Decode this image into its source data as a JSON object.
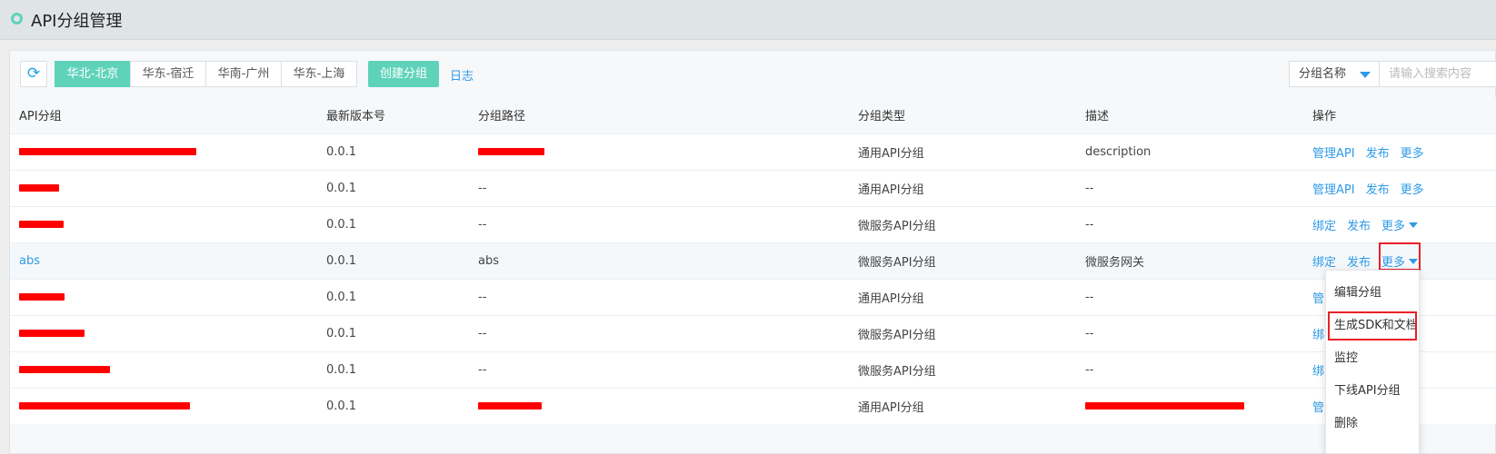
{
  "page": {
    "title": "API分组管理"
  },
  "toolbar": {
    "refresh_icon": "refresh-icon",
    "regions": [
      "华北-北京",
      "华东-宿迁",
      "华南-广州",
      "华东-上海"
    ],
    "active_region": "华北-北京",
    "create_label": "创建分组",
    "log_label": "日志",
    "search_field": "分组名称",
    "search_placeholder": "请输入搜索内容"
  },
  "table": {
    "headers": [
      "API分组",
      "最新版本号",
      "分组路径",
      "分组类型",
      "描述",
      "操作"
    ],
    "rows": [
      {
        "name": "",
        "version": "0.0.1",
        "path": "",
        "type": "通用API分组",
        "desc": "description",
        "ops": [
          "管理API",
          "发布",
          "更多"
        ]
      },
      {
        "name": "",
        "version": "0.0.1",
        "path": "--",
        "type": "通用API分组",
        "desc": "--",
        "ops": [
          "管理API",
          "发布",
          "更多"
        ]
      },
      {
        "name": "",
        "version": "0.0.1",
        "path": "--",
        "type": "微服务API分组",
        "desc": "--",
        "ops": [
          "绑定",
          "发布",
          "更多"
        ]
      },
      {
        "name": "abs",
        "version": "0.0.1",
        "path": "abs",
        "type": "微服务API分组",
        "desc": "微服务网关",
        "ops": [
          "绑定",
          "发布",
          "更多"
        ]
      },
      {
        "name": "",
        "version": "0.0.1",
        "path": "--",
        "type": "通用API分组",
        "desc": "--",
        "ops": [
          "管"
        ]
      },
      {
        "name": "",
        "version": "0.0.1",
        "path": "--",
        "type": "微服务API分组",
        "desc": "--",
        "ops": [
          "绑"
        ]
      },
      {
        "name": "",
        "version": "0.0.1",
        "path": "--",
        "type": "微服务API分组",
        "desc": "--",
        "ops": [
          "绑"
        ]
      },
      {
        "name": "",
        "version": "0.0.1",
        "path": "",
        "type": "通用API分组",
        "desc": "",
        "ops": [
          "管"
        ]
      }
    ]
  },
  "dropdown": {
    "items": [
      "编辑分组",
      "生成SDK和文档",
      "监控",
      "下线API分组",
      "删除"
    ]
  },
  "colors": {
    "accent": "#5fd3b9",
    "link": "#2e9ae6",
    "highlight": "#e8212a",
    "redaction": "#ff0000"
  }
}
